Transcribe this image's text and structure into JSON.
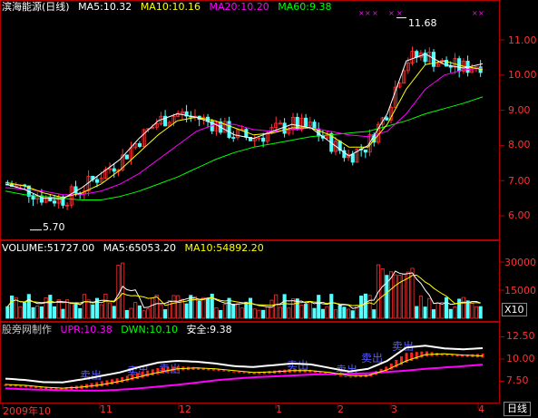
{
  "price_panel": {
    "title": "滨海能源(日线)",
    "ma5": "MA5:10.32",
    "ma10": "MA10:10.16",
    "ma20": "MA20:10.20",
    "ma60": "MA60:9.38",
    "high_label": "11.68",
    "low_label": "5.70",
    "y_ticks": [
      "11.00",
      "10.00",
      "9.00",
      "8.00",
      "7.00",
      "6.00"
    ]
  },
  "volume_panel": {
    "volume": "VOLUME:51727.00",
    "ma5": "MA5:65053.20",
    "ma10": "MA10:54892.20",
    "y_ticks": [
      "30000",
      "15000"
    ],
    "unit": "X10"
  },
  "indicator_panel": {
    "title": "股旁网制作",
    "upr": "UPR:10.38",
    "dwn": "DWN:10.10",
    "safe": "安全:9.38",
    "y_ticks": [
      "12.50",
      "10.00",
      "7.50"
    ],
    "signals": [
      "卖出",
      "卖出",
      "卖出",
      "卖出",
      "卖出",
      "卖出",
      "卖出"
    ]
  },
  "time_axis": {
    "labels": [
      "2009年10",
      "11",
      "12",
      "1",
      "2",
      "3",
      "4"
    ],
    "period_button": "日线"
  },
  "colors": {
    "up": "#ff3232",
    "down": "#54ffff",
    "ma5": "#ffffff",
    "ma10": "#ffff00",
    "ma20": "#ff00ff",
    "ma60": "#00ff00",
    "frame": "#b00000",
    "axis_text": "#ff3232"
  },
  "chart_data": {
    "type": "candlestick",
    "series": [
      {
        "name": "MA5",
        "values": [
          6.9,
          6.75,
          6.5,
          6.48,
          6.8,
          7.2,
          7.6,
          8.2,
          8.7,
          8.9,
          8.8,
          8.6,
          8.3,
          8.2,
          8.4,
          8.6,
          8.5,
          8.1,
          7.7,
          8.0,
          8.9,
          10.4,
          10.6,
          10.3,
          10.2,
          10.32
        ]
      },
      {
        "name": "MA10",
        "values": [
          6.95,
          6.85,
          6.65,
          6.52,
          6.65,
          6.9,
          7.3,
          7.8,
          8.3,
          8.7,
          8.8,
          8.7,
          8.5,
          8.3,
          8.35,
          8.5,
          8.5,
          8.3,
          7.95,
          7.95,
          8.6,
          9.6,
          10.3,
          10.4,
          10.25,
          10.16
        ]
      },
      {
        "name": "MA20",
        "values": [
          6.8,
          6.75,
          6.7,
          6.6,
          6.6,
          6.7,
          6.9,
          7.2,
          7.6,
          8.0,
          8.4,
          8.6,
          8.6,
          8.45,
          8.4,
          8.45,
          8.5,
          8.4,
          8.3,
          8.25,
          8.4,
          8.9,
          9.6,
          10.0,
          10.15,
          10.2
        ]
      },
      {
        "name": "MA60",
        "values": [
          6.7,
          6.6,
          6.55,
          6.5,
          6.45,
          6.45,
          6.55,
          6.7,
          6.9,
          7.1,
          7.35,
          7.6,
          7.8,
          7.95,
          8.05,
          8.15,
          8.25,
          8.3,
          8.35,
          8.4,
          8.55,
          8.7,
          8.9,
          9.05,
          9.2,
          9.38
        ]
      }
    ],
    "highest": 11.68,
    "lowest": 5.7,
    "ylim": [
      5.5,
      11.9
    ]
  }
}
